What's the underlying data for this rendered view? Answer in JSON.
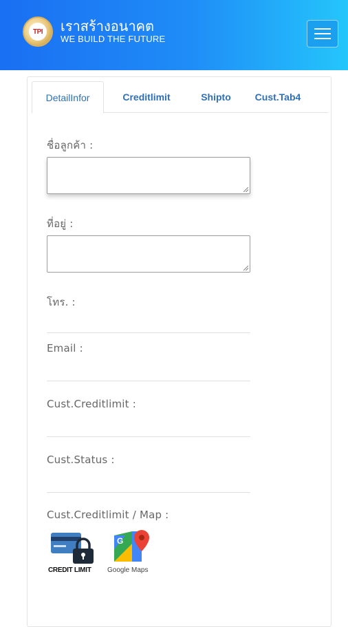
{
  "header": {
    "brand_title": "เราสร้างอนาคต",
    "brand_subtitle": "WE BUILD THE FUTURE",
    "logo_text": "TPI",
    "menu_icon": "hamburger-menu-icon"
  },
  "tabs": [
    {
      "label": "DetailInfor",
      "active": true
    },
    {
      "label": "Creditlimit",
      "active": false
    },
    {
      "label": "Shipto",
      "active": false
    },
    {
      "label": "Cust.Tab4",
      "active": false
    }
  ],
  "form": {
    "customer_name_label": "ชื่อลูกค้า :",
    "customer_name_value": "",
    "address_label": "ที่อยู่ :",
    "address_value": "",
    "phone_label": "โทร. :",
    "email_label": "Email :",
    "creditlimit_label": "Cust.Creditlimit :",
    "status_label": "Cust.Status :",
    "creditlimit_map_label": "Cust.Creditlimit / Map :"
  },
  "links": {
    "credit_limit_caption": "CREDIT LIMIT",
    "google_maps_caption": "Google Maps"
  },
  "colors": {
    "header_gradient_start": "#1a6ff2",
    "header_gradient_end": "#24c6fb",
    "tab_text": "#2f6fb5",
    "label_text": "#666666"
  }
}
